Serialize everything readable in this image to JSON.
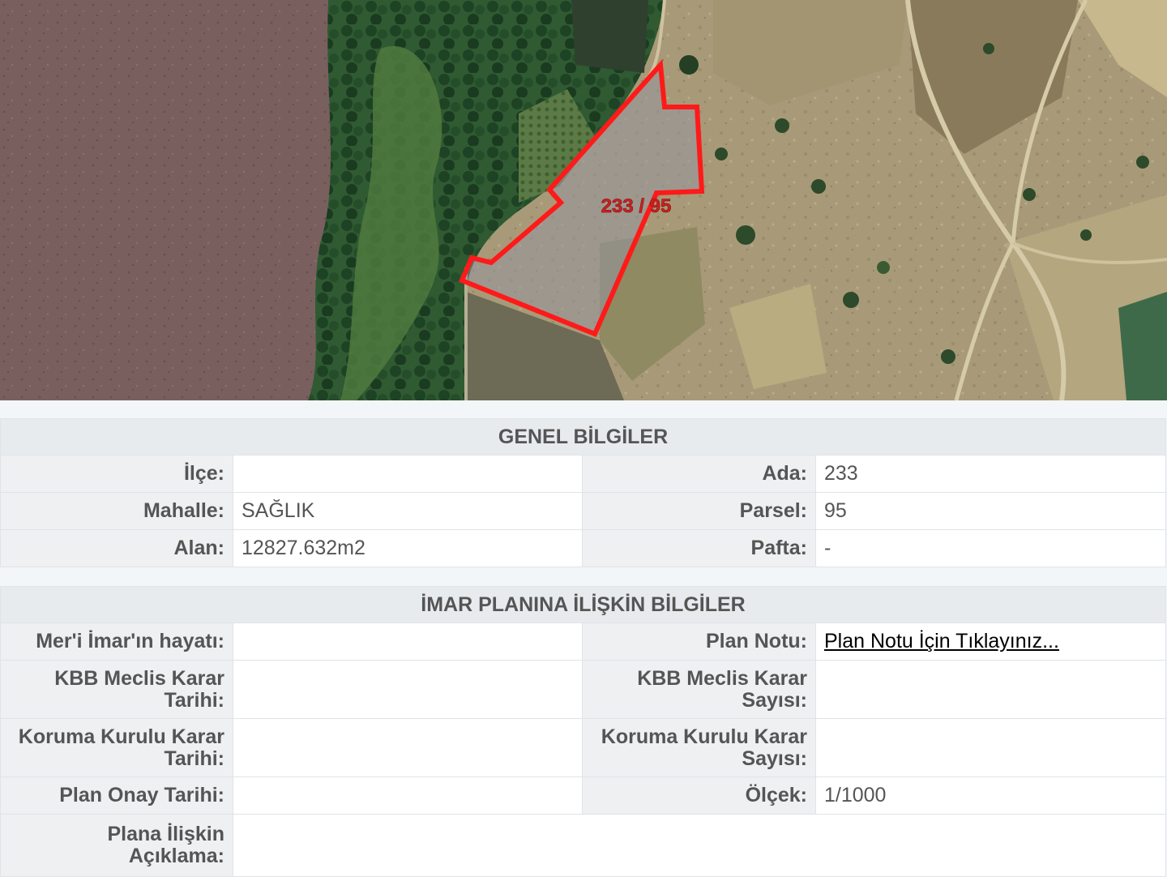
{
  "map": {
    "parcel_label": "233 / 95"
  },
  "general": {
    "title": "GENEL BİLGİLER",
    "ilce_label": "İlçe:",
    "ilce_value": "",
    "ada_label": "Ada:",
    "ada_value": "233",
    "mahalle_label": "Mahalle:",
    "mahalle_value": "SAĞLIK",
    "parsel_label": "Parsel:",
    "parsel_value": "95",
    "alan_label": "Alan:",
    "alan_value": "12827.632m2",
    "pafta_label": "Pafta:",
    "pafta_value": "-"
  },
  "imar": {
    "title": "İMAR PLANINA İLİŞKİN BİLGİLER",
    "meri_label": "Mer'i İmar'ın hayatı:",
    "meri_value": "",
    "plan_notu_label": "Plan Notu:",
    "plan_notu_link": "Plan Notu İçin Tıklayınız...",
    "kbb_tarih_label_1": "KBB Meclis Karar",
    "kbb_tarih_label_2": "Tarihi:",
    "kbb_tarih_value": "",
    "kbb_sayi_label_1": "KBB Meclis Karar",
    "kbb_sayi_label_2": "Sayısı:",
    "kbb_sayi_value": "",
    "koruma_tarih_label_1": "Koruma Kurulu Karar",
    "koruma_tarih_label_2": "Tarihi:",
    "koruma_tarih_value": "",
    "koruma_sayi_label_1": "Koruma Kurulu Karar",
    "koruma_sayi_label_2": "Sayısı:",
    "koruma_sayi_value": "",
    "plan_onay_label": "Plan Onay Tarihi:",
    "plan_onay_value": "",
    "olcek_label": "Ölçek:",
    "olcek_value": "1/1000",
    "aciklama_label_1": "Plana İlişkin",
    "aciklama_label_2": "Açıklama:",
    "aciklama_value": ""
  }
}
